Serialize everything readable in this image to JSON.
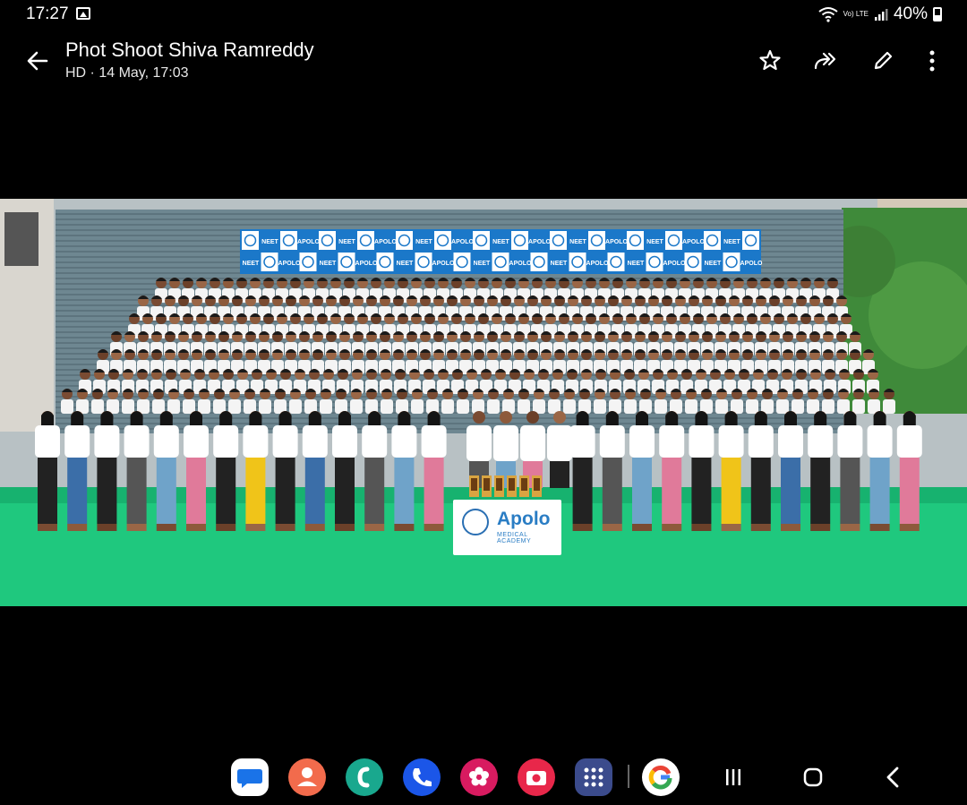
{
  "status_bar": {
    "time": "17:27",
    "network": "Vo) LTE",
    "battery": "40%"
  },
  "header": {
    "title": "Phot Shoot Shiva Ramreddy",
    "subtitle": "HD · 14 May, 17:03"
  },
  "photo": {
    "backdrop_words": [
      "NEET",
      "APOLO"
    ],
    "sign_brand": "Apolo",
    "sign_subtitle": "MEDICAL ACADEMY"
  },
  "colors": {
    "background": "#000000",
    "turf": "#1fc87e",
    "backdrop_blue": "#1b78c9",
    "accent": "#ffffff"
  },
  "icons": {
    "header": [
      "back-arrow-icon",
      "star-icon",
      "share-icon",
      "edit-icon",
      "more-options-icon"
    ],
    "dock": [
      "messages-app-icon",
      "contacts-app-icon",
      "phone-app-icon",
      "call-app-icon",
      "gallery-app-icon",
      "camera-app-icon",
      "apps-grid-icon",
      "google-app-icon"
    ],
    "nav": [
      "recents-nav-icon",
      "home-nav-icon",
      "back-nav-icon"
    ]
  }
}
